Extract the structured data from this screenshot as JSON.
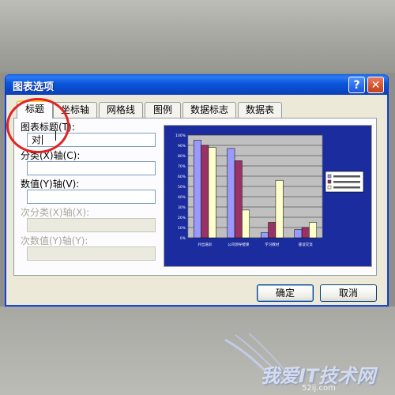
{
  "dialog": {
    "title": "图表选项",
    "help_glyph": "?",
    "close_glyph": "✕"
  },
  "tabs": [
    {
      "label": "标题",
      "active": true
    },
    {
      "label": "坐标轴",
      "active": false
    },
    {
      "label": "网格线",
      "active": false
    },
    {
      "label": "图例",
      "active": false
    },
    {
      "label": "数据标志",
      "active": false
    },
    {
      "label": "数据表",
      "active": false
    }
  ],
  "fields": {
    "chart_title": {
      "label": "图表标题(T):",
      "value": "对"
    },
    "category_x": {
      "label": "分类(X)轴(C):",
      "value": ""
    },
    "value_y": {
      "label": "数值(Y)轴(V):",
      "value": ""
    },
    "secondary_category_x": {
      "label": "次分类(X)轴(X):",
      "value": ""
    },
    "secondary_value_y": {
      "label": "次数值(Y)轴(Y):",
      "value": ""
    }
  },
  "buttons": {
    "ok": "确定",
    "cancel": "取消"
  },
  "watermark": {
    "text": "我爱IT技术网",
    "url": "52ij.com"
  },
  "colors": {
    "preview_bg": "#1a2c9e",
    "plot_bg": "#c0c0c0",
    "series": [
      "#9999ff",
      "#993366",
      "#ffffcc"
    ]
  },
  "chart_data": {
    "type": "bar",
    "categories": [
      "外出培训",
      "公司领导授课",
      "学习教材",
      "座谈交流"
    ],
    "series": [
      {
        "name": "",
        "values": [
          95,
          87,
          5,
          8
        ]
      },
      {
        "name": "",
        "values": [
          90,
          75,
          15,
          10
        ]
      },
      {
        "name": "",
        "values": [
          88,
          27,
          56,
          15
        ]
      }
    ],
    "ylim": [
      0,
      100
    ],
    "y_ticks": [
      "0%",
      "10%",
      "20%",
      "30%",
      "40%",
      "50%",
      "60%",
      "70%",
      "80%",
      "90%",
      "100%"
    ],
    "grid": true,
    "legend": "right"
  }
}
